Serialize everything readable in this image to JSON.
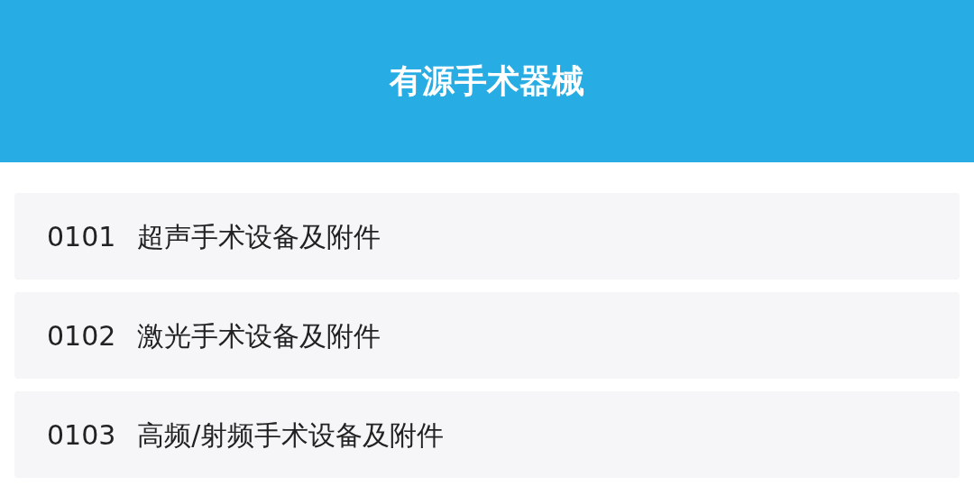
{
  "header": {
    "title": "有源手术器械"
  },
  "items": [
    {
      "code": "0101",
      "name": "超声手术设备及附件"
    },
    {
      "code": "0102",
      "name": "激光手术设备及附件"
    },
    {
      "code": "0103",
      "name": "高频/射频手术设备及附件"
    }
  ]
}
